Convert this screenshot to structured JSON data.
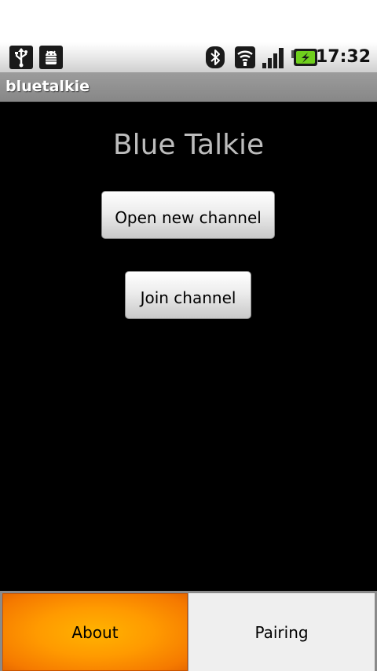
{
  "status_bar": {
    "time": "17:32",
    "left_icons": [
      "usb-icon",
      "android-debug-icon"
    ],
    "right_icons": [
      "bluetooth-icon",
      "wifi-icon",
      "signal-icon",
      "battery-charging-icon"
    ]
  },
  "title_bar": {
    "title": "bluetalkie"
  },
  "main": {
    "heading": "Blue Talkie",
    "open_channel_label": "Open new channel",
    "join_channel_label": "Join channel"
  },
  "options_menu": {
    "about_label": "About",
    "pairing_label": "Pairing"
  },
  "colors": {
    "status_bar_bg": "#e6e6e6",
    "title_bar_bg": "#909090",
    "content_bg": "#000000",
    "heading_text": "#bdbdbd",
    "menu_selected": "#ff9a00",
    "menu_normal": "#efefef"
  }
}
